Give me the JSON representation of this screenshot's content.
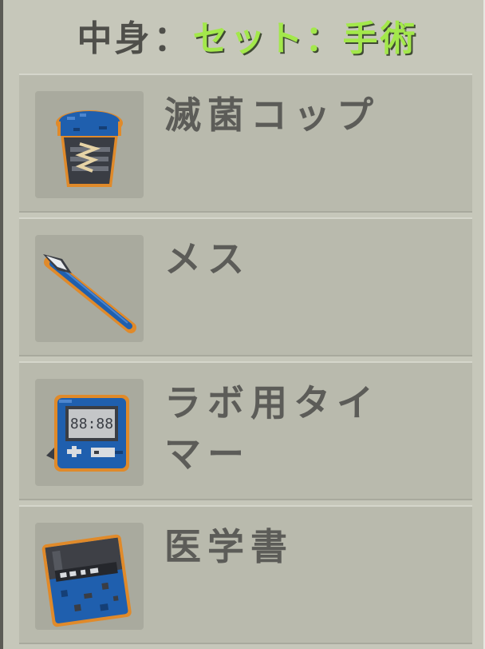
{
  "header": {
    "label": "中身",
    "separator": "：",
    "set_name": "セット：手術"
  },
  "items": [
    {
      "name": "滅菌コップ",
      "icon": "sterile-cup-icon"
    },
    {
      "name": "メス",
      "icon": "scalpel-icon"
    },
    {
      "name": "ラボ用タイマー",
      "icon": "lab-timer-icon"
    },
    {
      "name": "医学書",
      "icon": "medical-book-icon"
    }
  ],
  "colors": {
    "panel_bg": "#c6c7ba",
    "item_bg": "#b9baad",
    "set_name_green": "#a3e84b",
    "text_gray": "#5c5c58",
    "icon_blue": "#1f5fae",
    "icon_outline_orange": "#e08a2a"
  }
}
